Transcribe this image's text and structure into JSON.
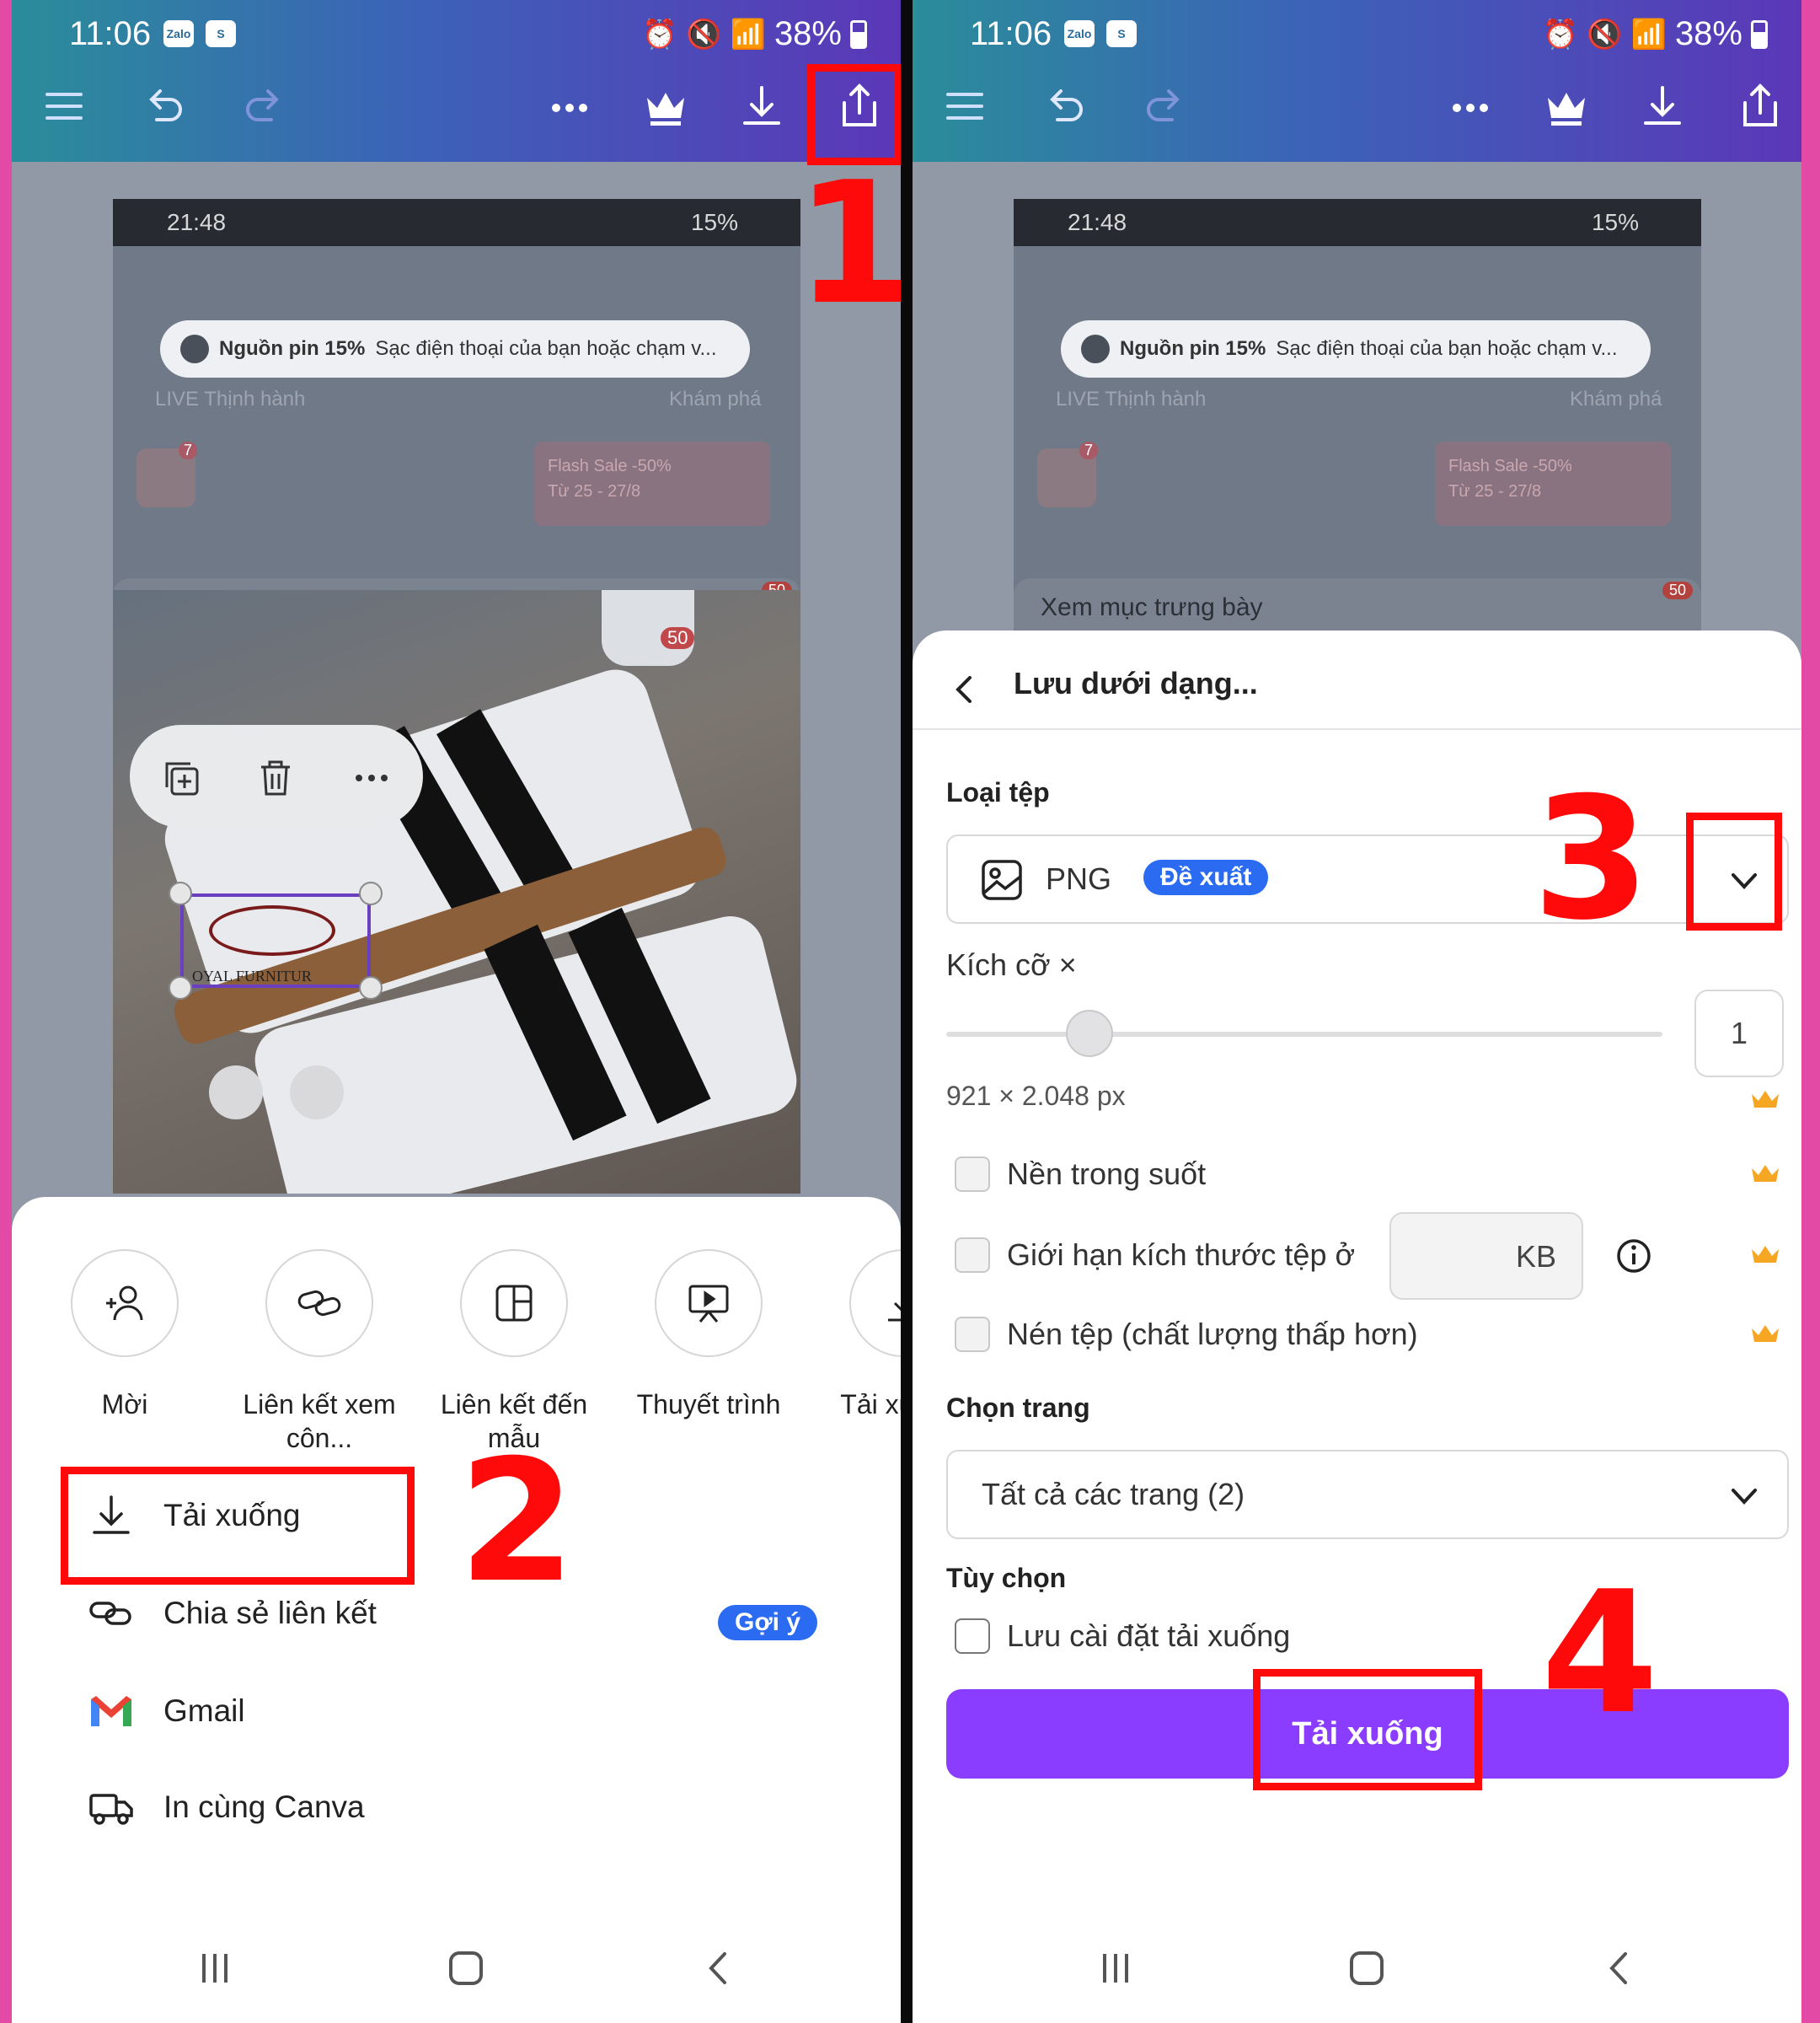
{
  "status": {
    "time": "11:06",
    "battery": "38%",
    "zalo_badge": "Zalo",
    "shop_badge": "S",
    "lte": "LTE2"
  },
  "annotations": {
    "step1": "1",
    "step2": "2",
    "step3": "3",
    "step4": "4",
    "highlight_color": "#ff0a0a"
  },
  "canvas_preview": {
    "time": "21:48",
    "battery": "15%",
    "notif_bold": "Nguồn pin 15%",
    "notif_text": "Sạc điện thoại của bạn hoặc chạm v...",
    "live": "LIVE Thịnh hành",
    "explore": "Khám phá",
    "flash1": "Flash Sale -50%",
    "flash2": "Từ 25 - 27/8",
    "display_link": "Xem mục trưng bày",
    "cart_count": "50",
    "cart_count2": "50",
    "calendar_badge": "7",
    "logo_text": "OYAL FURNITUR"
  },
  "share_sheet": {
    "items": [
      {
        "label": "Mời",
        "icon": "invite-people-icon"
      },
      {
        "label": "Liên kết xem côn...",
        "icon": "link-icon"
      },
      {
        "label": "Liên kết đến mẫu",
        "icon": "template-icon"
      },
      {
        "label": "Thuyết trình",
        "icon": "present-icon"
      },
      {
        "label": "Tải xu phầ",
        "icon": "download-icon"
      }
    ],
    "download": "Tải xuống",
    "share_link": "Chia sẻ liên kết",
    "suggest_badge": "Gợi ý",
    "gmail": "Gmail",
    "print": "In cùng Canva"
  },
  "save_panel": {
    "title": "Lưu dưới dạng...",
    "file_type_label": "Loại tệp",
    "file_type": "PNG",
    "recommended": "Đề xuất",
    "size_label": "Kích cỡ ×",
    "size_value": "1",
    "size_fraction": 0.2,
    "dimensions": "921 × 2.048 px",
    "transparent": "Nền trong suốt",
    "limit_size": "Giới hạn kích thước tệp ở",
    "kb_unit": "KB",
    "compress": "Nén tệp (chất lượng thấp hơn)",
    "pages_label": "Chọn trang",
    "pages_value": "Tất cả các trang (2)",
    "options_label": "Tùy chọn",
    "save_settings": "Lưu cài đặt tải xuống",
    "download_button": "Tải xuống",
    "accent": "#8b3dff",
    "crown_color": "#f5a623"
  }
}
